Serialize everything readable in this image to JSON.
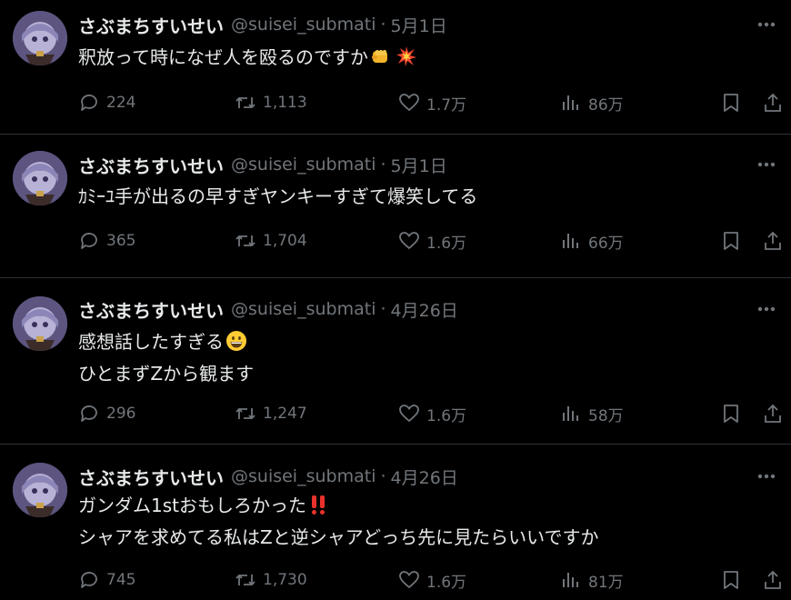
{
  "tweets": [
    {
      "name": "さぶまちすいせい",
      "handle": "@suisei_submati",
      "date": "5月1日",
      "lines": [
        "釈放って時になぜ人を殴るのですか"
      ],
      "emoji": [
        "fist-emoji",
        "collision-emoji"
      ],
      "replies": "224",
      "retweets": "1,113",
      "likes": "1.7万",
      "views": "86万"
    },
    {
      "name": "さぶまちすいせい",
      "handle": "@suisei_submati",
      "date": "5月1日",
      "lines": [
        "ｶﾐｰﾕ手が出るの早すぎヤンキーすぎて爆笑してる"
      ],
      "emoji": [],
      "replies": "365",
      "retweets": "1,704",
      "likes": "1.6万",
      "views": "66万"
    },
    {
      "name": "さぶまちすいせい",
      "handle": "@suisei_submati",
      "date": "4月26日",
      "lines": [
        "感想話したすぎる",
        "ひとまずZから観ます"
      ],
      "emoji": [
        "grinning-face-emoji"
      ],
      "replies": "296",
      "retweets": "1,247",
      "likes": "1.6万",
      "views": "58万"
    },
    {
      "name": "さぶまちすいせい",
      "handle": "@suisei_submati",
      "date": "4月26日",
      "lines": [
        "ガンダム1stおもしろかった",
        "シャアを求めてる私はZと逆シャアどっち先に見たらいいですか"
      ],
      "emoji": [
        "double-exclamation-emoji"
      ],
      "replies": "745",
      "retweets": "1,730",
      "likes": "1.6万",
      "views": "81万"
    }
  ],
  "separator": "·",
  "colors": {
    "background": "#000000",
    "text": "#e7e9ea",
    "muted": "#71767b",
    "divider": "#2f3336"
  }
}
